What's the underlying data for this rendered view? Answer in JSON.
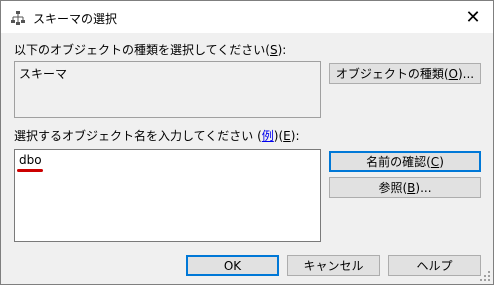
{
  "window": {
    "title": "スキーマの選択",
    "close_glyph": "✕"
  },
  "object_types": {
    "label_prefix": "以下のオブジェクトの種類を選択してください(",
    "label_accel": "S",
    "label_suffix": "):",
    "value": "スキーマ",
    "button_prefix": "オブジェクトの種類(",
    "button_accel": "O",
    "button_suffix": ")..."
  },
  "object_names": {
    "label_prefix": "選択するオブジェクト名を入力してください (",
    "example_link": "例",
    "label_mid": ")(",
    "label_accel": "E",
    "label_suffix": "):",
    "value": "dbo"
  },
  "buttons": {
    "check_names_prefix": "名前の確認(",
    "check_names_accel": "C",
    "check_names_suffix": ")",
    "browse_prefix": "参照(",
    "browse_accel": "B",
    "browse_suffix": ")...",
    "ok": "OK",
    "cancel": "キャンセル",
    "help": "ヘルプ"
  },
  "colors": {
    "accent": "#0078d7",
    "annotation_red": "#cc0000"
  }
}
